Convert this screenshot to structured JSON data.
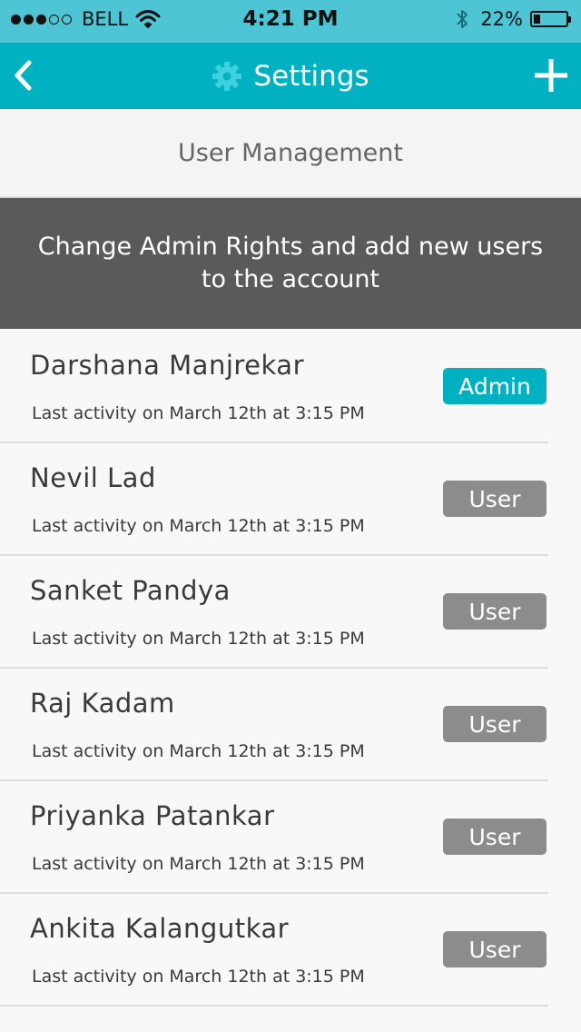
{
  "status_bar": {
    "carrier": "BELL",
    "time": "4:21 PM",
    "battery_percent_text": "22%",
    "battery_level": 0.22,
    "signal_bars": 3,
    "signal_total": 5
  },
  "nav": {
    "title": "Settings",
    "back_icon": "chevron-left-icon",
    "title_icon": "gear-icon",
    "add_icon": "plus-icon"
  },
  "section": {
    "title": "User Management"
  },
  "banner": {
    "text": "Change Admin Rights and add new users to the account"
  },
  "users": [
    {
      "name": "Darshana Manjrekar",
      "activity": "Last activity on March 12th at 3:15 PM",
      "role": "Admin"
    },
    {
      "name": "Nevil Lad",
      "activity": "Last activity on March 12th at 3:15 PM",
      "role": "User"
    },
    {
      "name": "Sanket Pandya",
      "activity": "Last activity on March 12th at 3:15 PM",
      "role": "User"
    },
    {
      "name": "Raj Kadam",
      "activity": "Last activity on March 12th at 3:15 PM",
      "role": "User"
    },
    {
      "name": "Priyanka Patankar",
      "activity": "Last activity on March 12th at 3:15 PM",
      "role": "User"
    },
    {
      "name": "Ankita Kalangutkar",
      "activity": "Last activity on March 12th at 3:15 PM",
      "role": "User"
    }
  ],
  "colors": {
    "status_bar": "#4dc5d4",
    "nav_bar": "#00b1c1",
    "admin_badge": "#00b1c1",
    "user_badge": "#8c8c8c",
    "banner": "#5a5a5a"
  }
}
